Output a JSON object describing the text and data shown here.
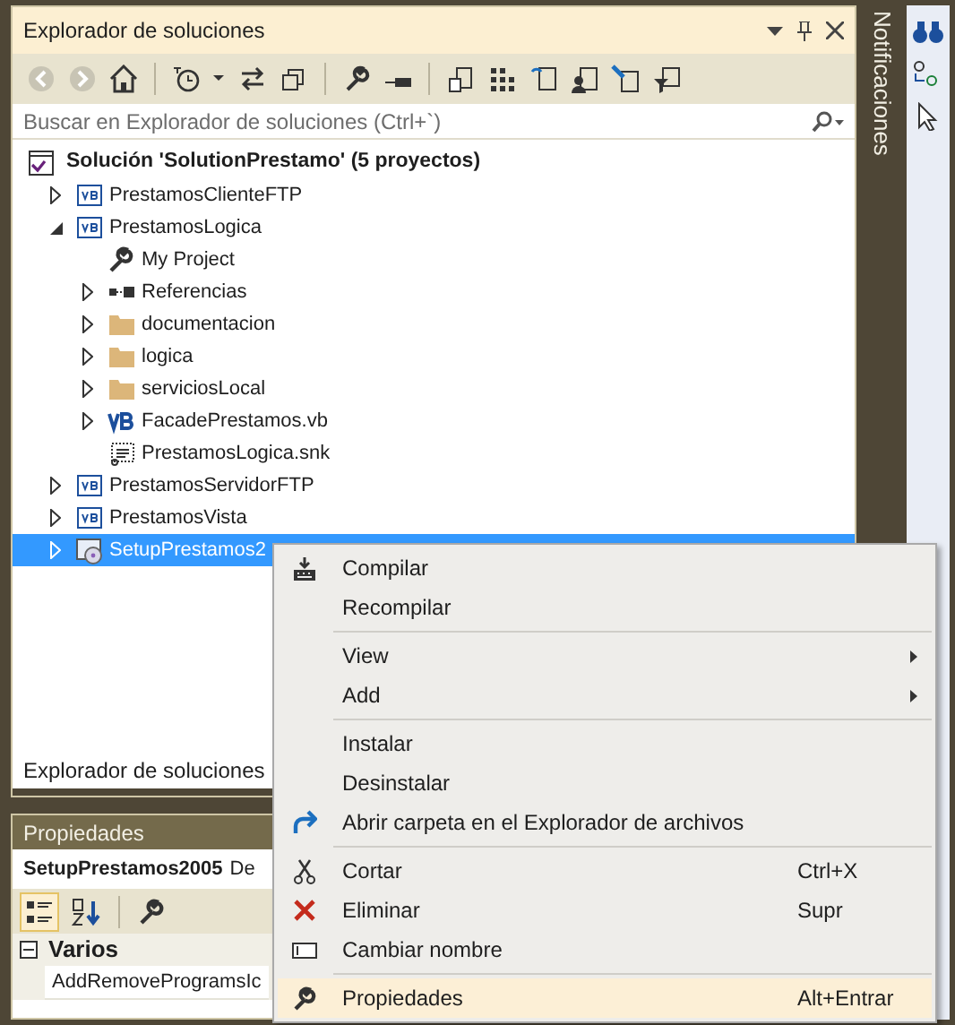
{
  "panel": {
    "title": "Explorador de soluciones"
  },
  "search": {
    "placeholder": "Buscar en Explorador de soluciones (Ctrl+`)"
  },
  "tree": {
    "label": "Solución 'SolutionPrestamo'  (5 proyectos)",
    "children": [
      {
        "label": "PrestamosClienteFTP",
        "kind": "vbproj",
        "expanded": false,
        "selected": false,
        "has_children": true
      },
      {
        "label": "PrestamosLogica",
        "kind": "vbproj",
        "expanded": true,
        "selected": false,
        "has_children": true,
        "children": [
          {
            "label": "My Project",
            "kind": "wrench",
            "expanded": false,
            "selected": false,
            "has_children": false
          },
          {
            "label": "Referencias",
            "kind": "refs",
            "expanded": false,
            "selected": false,
            "has_children": true
          },
          {
            "label": "documentacion",
            "kind": "folder",
            "expanded": false,
            "selected": false,
            "has_children": true
          },
          {
            "label": "logica",
            "kind": "folder",
            "expanded": false,
            "selected": false,
            "has_children": true
          },
          {
            "label": "serviciosLocal",
            "kind": "folder",
            "expanded": false,
            "selected": false,
            "has_children": true
          },
          {
            "label": "FacadePrestamos.vb",
            "kind": "vbfile",
            "expanded": false,
            "selected": false,
            "has_children": true
          },
          {
            "label": "PrestamosLogica.snk",
            "kind": "snk",
            "expanded": false,
            "selected": false,
            "has_children": false
          }
        ]
      },
      {
        "label": "PrestamosServidorFTP",
        "kind": "vbproj",
        "expanded": false,
        "selected": false,
        "has_children": true
      },
      {
        "label": "PrestamosVista",
        "kind": "vbproj",
        "expanded": false,
        "selected": false,
        "has_children": true
      },
      {
        "label": "SetupPrestamos2",
        "kind": "setup",
        "expanded": false,
        "selected": true,
        "has_children": true
      }
    ]
  },
  "bottom_tab": {
    "label": "Explorador de soluciones"
  },
  "side_tab": {
    "label": "Notificaciones"
  },
  "properties": {
    "title": "Propiedades",
    "object_name": "SetupPrestamos2005",
    "object_type": "De",
    "toolbar": [
      {
        "kind": "categorized",
        "selected": true
      },
      {
        "kind": "alpha",
        "selected": false
      },
      {
        "kind": "wrench",
        "selected": false
      }
    ],
    "category": {
      "label": "Varios",
      "expanded": true
    },
    "rows": [
      {
        "name": "AddRemoveProgramsIc"
      }
    ]
  },
  "context_menu": [
    {
      "kind": "build",
      "label": "Compilar",
      "highlighted": false
    },
    {
      "kind": "plain",
      "label": "Recompilar",
      "highlighted": false
    },
    {
      "kind": "separator"
    },
    {
      "kind": "submenu",
      "label": "View",
      "highlighted": false
    },
    {
      "kind": "submenu",
      "label": "Add",
      "highlighted": false
    },
    {
      "kind": "separator"
    },
    {
      "kind": "plain",
      "label": "Instalar",
      "highlighted": false
    },
    {
      "kind": "plain",
      "label": "Desinstalar",
      "highlighted": false
    },
    {
      "kind": "open",
      "label": "Abrir carpeta en el Explorador de archivos",
      "highlighted": false
    },
    {
      "kind": "separator"
    },
    {
      "kind": "cut",
      "label": "Cortar",
      "shortcut": "Ctrl+X",
      "highlighted": false
    },
    {
      "kind": "delete",
      "label": "Eliminar",
      "shortcut": "Supr",
      "highlighted": false
    },
    {
      "kind": "rename",
      "label": "Cambiar nombre",
      "highlighted": false
    },
    {
      "kind": "separator"
    },
    {
      "kind": "wrench",
      "label": "Propiedades",
      "shortcut": "Alt+Entrar",
      "highlighted": true
    }
  ]
}
